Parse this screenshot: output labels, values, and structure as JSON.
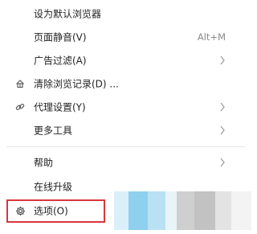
{
  "menu": {
    "items": [
      {
        "label": "设为默认浏览器",
        "shortcut": "",
        "has_submenu": false,
        "icon": ""
      },
      {
        "label": "页面静音(V)",
        "shortcut": "Alt+M",
        "has_submenu": false,
        "icon": ""
      },
      {
        "label": "广告过滤(A)",
        "shortcut": "",
        "has_submenu": true,
        "icon": ""
      },
      {
        "label": "清除浏览记录(D) ...",
        "shortcut": "",
        "has_submenu": false,
        "icon": "broom-icon"
      },
      {
        "label": "代理设置(Y)",
        "shortcut": "",
        "has_submenu": true,
        "icon": "link-icon"
      },
      {
        "label": "更多工具",
        "shortcut": "",
        "has_submenu": true,
        "icon": ""
      },
      {
        "label": "帮助",
        "shortcut": "",
        "has_submenu": true,
        "icon": ""
      },
      {
        "label": "在线升级",
        "shortcut": "",
        "has_submenu": false,
        "icon": ""
      },
      {
        "label": "选项(O)",
        "shortcut": "",
        "has_submenu": false,
        "icon": "gear-icon"
      }
    ]
  },
  "colors": {
    "highlight_border": "#d9363e",
    "shortcut_text": "#8a8a8a"
  }
}
